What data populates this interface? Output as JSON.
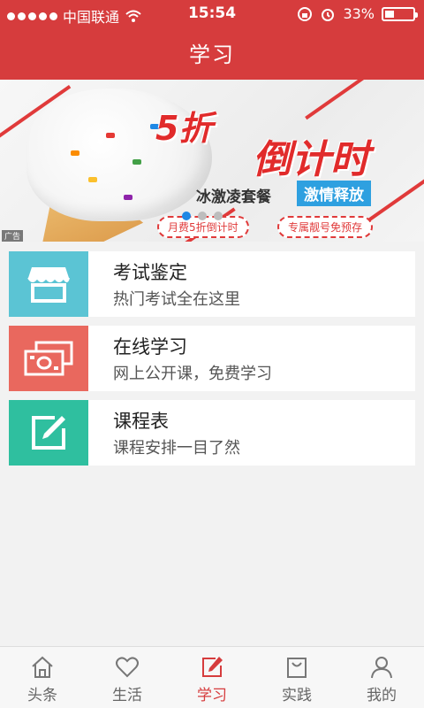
{
  "status_bar": {
    "carrier": "中国联通",
    "time": "15:54",
    "battery": "33%",
    "battery_level": 0.33,
    "signal_icon": "signal-dots-icon",
    "wifi_icon": "wifi-icon",
    "lock_icon": "orientation-lock-icon",
    "alarm_icon": "alarm-clock-icon"
  },
  "header": {
    "title": "学习"
  },
  "banner": {
    "headline_1": "5折",
    "headline_2": "倒计时",
    "product": "冰激凌套餐",
    "highlight": "激情释放",
    "tag_left": "月费5折倒计时",
    "tag_right": "专属靓号免预存",
    "ad_label": "广告",
    "slides_total": 3,
    "active_slide": 1
  },
  "cards": [
    {
      "title": "考试鉴定",
      "subtitle": "热门考试全在这里",
      "icon": "storefront-icon",
      "color": "#5bc4d4"
    },
    {
      "title": "在线学习",
      "subtitle": "网上公开课，免费学习",
      "icon": "money-bills-icon",
      "color": "#e9685e"
    },
    {
      "title": "课程表",
      "subtitle": "课程安排一目了然",
      "icon": "edit-note-icon",
      "color": "#2fbf9f"
    }
  ],
  "tabbar": {
    "items": [
      {
        "label": "头条",
        "icon": "home-icon"
      },
      {
        "label": "生活",
        "icon": "heart-icon"
      },
      {
        "label": "学习",
        "icon": "edit-icon",
        "active": true
      },
      {
        "label": "实践",
        "icon": "shopping-bag-icon"
      },
      {
        "label": "我的",
        "icon": "user-icon"
      }
    ]
  },
  "colors": {
    "brand_red": "#d63c3d",
    "card_blue": "#5bc4d4",
    "card_red": "#e9685e",
    "card_green": "#2fbf9f"
  }
}
